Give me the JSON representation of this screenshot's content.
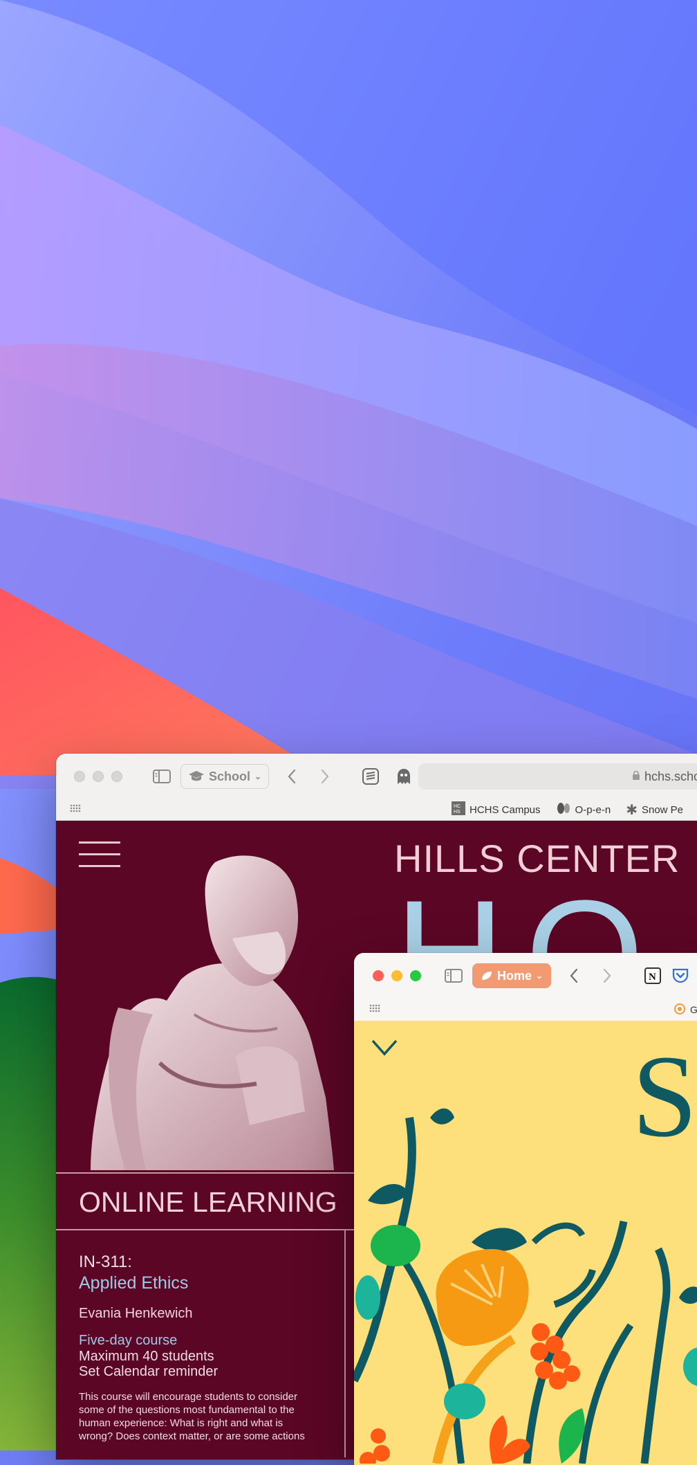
{
  "desktop": {
    "wallpaper": "macOS Sonoma wallpaper"
  },
  "school_window": {
    "profile_label": "School",
    "url": "hchs.school",
    "favorites": [
      {
        "label": "HCHS Campus",
        "icon": "hchs-logo-icon"
      },
      {
        "label": "O-p-e-n",
        "icon": "open-logo-icon"
      },
      {
        "label": "Snow Pe",
        "icon": "snowflake-icon"
      }
    ],
    "page": {
      "site_title": "HILLS CENTER",
      "big_letters": "HO",
      "section_title": "ONLINE LEARNING",
      "course_code": "IN-311:",
      "course_name": "Applied Ethics",
      "instructor": "Evania Henkewich",
      "duration": "Five-day course",
      "capacity": "Maximum 40 students",
      "reminder": "Set Calendar reminder",
      "description": "This course will encourage students to consider some of the questions most fundamental to the human experience: What is right and what is wrong? Does context matter, or are some actions"
    }
  },
  "home_window": {
    "profile_label": "Home",
    "favorites": [
      {
        "label": "Glo",
        "icon": "globe-icon"
      }
    ],
    "page": {
      "chevron": "chevron-down-icon",
      "big_letter": "S"
    }
  },
  "colors": {
    "school_bg": "#5b0625",
    "school_accent": "#a9d0e6",
    "home_bg": "#fde07b",
    "home_pill": "#f29b72",
    "close": "#fe5f57",
    "minimize": "#febc2e",
    "zoom": "#28c840"
  }
}
